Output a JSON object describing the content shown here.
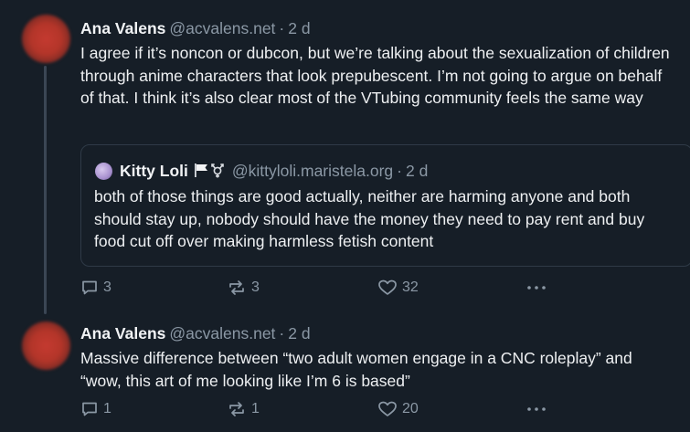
{
  "posts": [
    {
      "author": {
        "display_name": "Ana Valens",
        "handle": "@acvalens.net",
        "time": "2 d"
      },
      "text": "I agree if it’s noncon or dubcon, but we’re talking about the sexualization of children through anime characters that look prepubescent. I’m not going to argue on behalf of that. I think it’s also clear most of the VTubing community feels the same way",
      "quote": {
        "author": {
          "display_name": "Kitty Loli",
          "handle": "@kittyloli.maristela.org",
          "time": "2 d"
        },
        "text": "both of those things are good actually, neither are harming anyone and both should stay up, nobody should have the money they need to pay rent and buy food cut off over making harmless fetish content"
      },
      "stats": {
        "replies": "3",
        "reposts": "3",
        "likes": "32"
      }
    },
    {
      "author": {
        "display_name": "Ana Valens",
        "handle": "@acvalens.net",
        "time": "2 d"
      },
      "text": "Massive difference between “two adult women engage in a CNC roleplay” and “wow, this art of me looking like I’m 6 is based”",
      "stats": {
        "replies": "1",
        "reposts": "1",
        "likes": "20"
      }
    }
  ],
  "icons": {
    "reply": "speech-bubble-icon",
    "repost": "repost-arrows-icon",
    "like": "heart-icon",
    "more": "ellipsis-icon",
    "flags": "white-flag-and-transgender-symbol-icon"
  },
  "colors": {
    "background": "#161e27",
    "text": "#eef0f2",
    "muted": "#8b98a5",
    "border": "#2f3a47",
    "thread_line": "#3b4654"
  }
}
